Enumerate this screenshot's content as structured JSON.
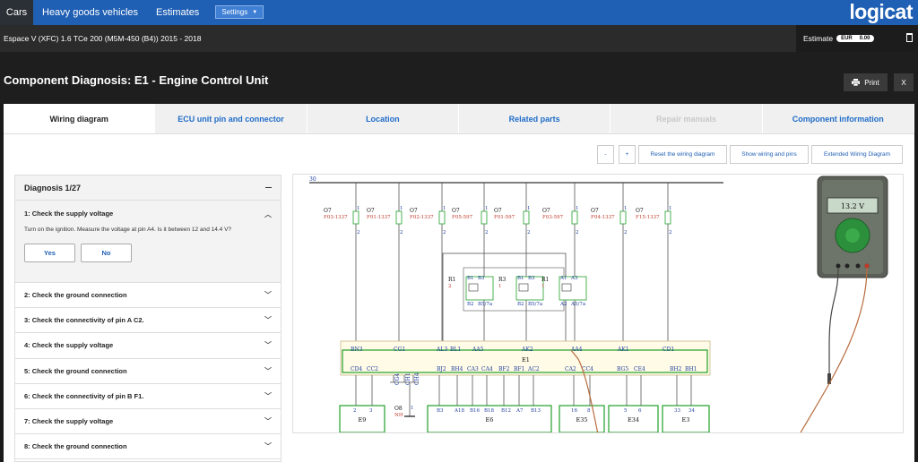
{
  "nav": {
    "tabs": [
      {
        "label": "Cars"
      },
      {
        "label": "Heavy goods vehicles"
      },
      {
        "label": "Estimates"
      }
    ],
    "settings_label": "Settings",
    "logo": "logicat"
  },
  "vehicle": {
    "name": "Espace V (XFC) 1.6 TCe 200 (M5M-450 (B4)) 2015 - 2018"
  },
  "estimate": {
    "label": "Estimate",
    "currency": "EUR",
    "amount": "0.00"
  },
  "page": {
    "title": "Component Diagnosis: E1 - Engine Control Unit",
    "print_label": "Print",
    "close_label": "X"
  },
  "tabs": [
    {
      "label": "Wiring diagram"
    },
    {
      "label": "ECU unit pin and connector"
    },
    {
      "label": "Location"
    },
    {
      "label": "Related parts"
    },
    {
      "label": "Repair manuals"
    },
    {
      "label": "Component information"
    }
  ],
  "toolbar": {
    "minus": "-",
    "plus": "+",
    "reset": "Reset the wiring diagram",
    "show": "Show wiring and pins",
    "extended": "Extended Wiring Diagram"
  },
  "diagnosis": {
    "header": "Diagnosis 1/27",
    "open_step": {
      "title": "1: Check the supply voltage",
      "description": "Turn on the ignition. Measure the voltage at pin A4. Is it between 12 and 14.4 V?",
      "yes": "Yes",
      "no": "No"
    },
    "steps": [
      {
        "label": "2: Check the ground connection"
      },
      {
        "label": "3: Check the connectivity of pin A C2."
      },
      {
        "label": "4: Check the supply voltage"
      },
      {
        "label": "5: Check the ground connection"
      },
      {
        "label": "6: Check the connectivity of pin B F1."
      },
      {
        "label": "7: Check the supply voltage"
      },
      {
        "label": "8: Check the ground connection"
      }
    ]
  },
  "wiring": {
    "bus_label": "30",
    "fuses": [
      {
        "code": "O7",
        "name": "F03-1337",
        "pin_top": "1",
        "pin_bottom": "2"
      },
      {
        "code": "O7",
        "name": "F01-1337",
        "pin_top": "1",
        "pin_bottom": "2"
      },
      {
        "code": "O7",
        "name": "F02-1337",
        "pin_top": "1",
        "pin_bottom": "2"
      },
      {
        "code": "O7",
        "name": "F05-597",
        "pin_top": "1",
        "pin_bottom": "2"
      },
      {
        "code": "O7",
        "name": "F01-597",
        "pin_top": "1",
        "pin_bottom": "2"
      },
      {
        "code": "O7",
        "name": "F03-597",
        "pin_top": "1",
        "pin_bottom": "2"
      },
      {
        "code": "O7",
        "name": "F04-1337",
        "pin_top": "1",
        "pin_bottom": "2"
      },
      {
        "code": "O7",
        "name": "F15-1337",
        "pin_top": "1",
        "pin_bottom": "2"
      }
    ],
    "relays": [
      {
        "name": "R1",
        "num": "2",
        "top_pins": [
          "B1",
          "B3"
        ],
        "bottom_pins": [
          "B2",
          "B5/7a"
        ]
      },
      {
        "name": "R3",
        "num": "1",
        "top_pins": [
          "B1",
          "B3"
        ],
        "bottom_pins": [
          "B2",
          "B5/7a"
        ]
      },
      {
        "name": "R1",
        "num": "1",
        "top_pins": [
          "A1",
          "A3"
        ],
        "bottom_pins": [
          "A2",
          "A5/7a"
        ]
      }
    ],
    "ecu": {
      "name": "E1",
      "top_pins": [
        "BN3",
        "CG1",
        "AL3",
        "BL1",
        "AA5",
        "AK2",
        "AA4",
        "AK1",
        "CD1"
      ],
      "bottom_pins": [
        "CD4",
        "CC2",
        "CG4",
        "CH1",
        "CH4",
        "BJ2",
        "BH4",
        "CA3",
        "CA4",
        "BF2",
        "BF1",
        "AC2",
        "CA2",
        "CC4",
        "BG5",
        "CE4",
        "BH2",
        "BH1"
      ]
    },
    "ground": {
      "name": "O8",
      "sub": "NH",
      "pin": "1"
    },
    "connectors": [
      {
        "name": "E9",
        "pins": [
          "2",
          "3"
        ]
      },
      {
        "name": "E6",
        "pins": [
          "B3",
          "A18",
          "B16",
          "B18",
          "B12",
          "A7",
          "B13"
        ]
      },
      {
        "name": "E35",
        "pins": [
          "16",
          "8"
        ]
      },
      {
        "name": "E34",
        "pins": [
          "5",
          "6"
        ]
      },
      {
        "name": "E3",
        "pins": [
          "33",
          "34"
        ]
      }
    ]
  },
  "multimeter": {
    "reading": "13.2 V"
  },
  "colors": {
    "nav_blue": "#1f5fb4",
    "link_blue": "#1f6cc8",
    "wire_green": "#22a02a",
    "fuse_red": "#c0392b",
    "probe_wire": "#b86b3c"
  }
}
